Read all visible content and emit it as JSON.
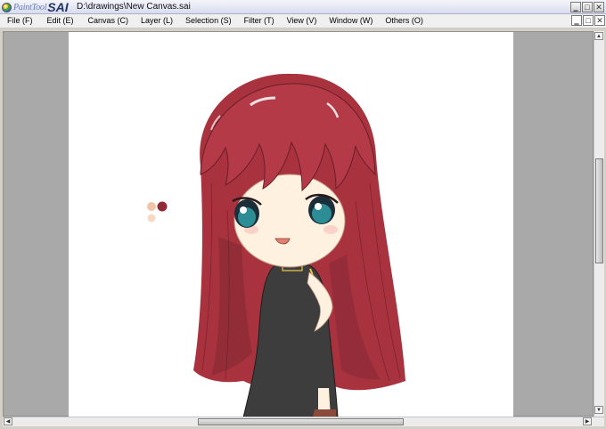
{
  "app": {
    "logo_small": "PaintTool",
    "logo_big": "SAI",
    "file_path": "D:\\drawings\\New Canvas.sai"
  },
  "window_buttons": {
    "minimize": "‗",
    "maximize": "□",
    "close": "✕"
  },
  "menu": [
    {
      "label": "File (F)"
    },
    {
      "label": "Edit (E)"
    },
    {
      "label": "Canvas (C)"
    },
    {
      "label": "Layer (L)"
    },
    {
      "label": "Selection (S)"
    },
    {
      "label": "Filter (T)"
    },
    {
      "label": "View (V)"
    },
    {
      "label": "Window (W)"
    },
    {
      "label": "Others (O)"
    }
  ],
  "colors": {
    "hair": "#b23a44",
    "hair_dark": "#7a2630",
    "skin": "#fff1df",
    "dress": "#3b3b3b",
    "eyes": "#2c8e94",
    "dress_trim": "#e8c94a"
  },
  "icons": {
    "logo": "painttool-sai-logo-icon",
    "scroll_up": "scroll-up-arrow-icon",
    "scroll_down": "scroll-down-arrow-icon",
    "scroll_left": "scroll-left-arrow-icon",
    "scroll_right": "scroll-right-arrow-icon"
  },
  "scroll": {
    "vertical_position": 0.33,
    "horizontal_position": 0.32
  }
}
